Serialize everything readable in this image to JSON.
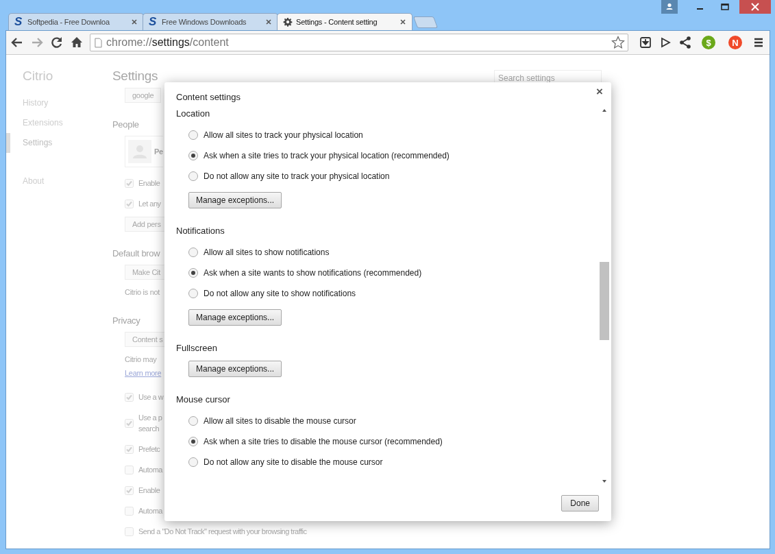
{
  "tabs": [
    {
      "label": "Softpedia - Free Downloa",
      "kind": "logo",
      "logo": "S",
      "selected": false
    },
    {
      "label": "Free Windows Downloads",
      "kind": "logo",
      "logo": "S",
      "selected": false
    },
    {
      "label": "Settings - Content setting",
      "kind": "gear",
      "selected": true
    }
  ],
  "address_bar": {
    "scheme": "chrome://",
    "host": "settings",
    "path": "/content"
  },
  "extensions": [
    {
      "label": "$",
      "color": "#6aa81a"
    },
    {
      "label": "N",
      "color": "#f04a2a"
    }
  ],
  "sidebar": {
    "title": "Citrio",
    "items": [
      {
        "label": "History",
        "selected": false
      },
      {
        "label": "Extensions",
        "selected": false
      },
      {
        "label": "Settings",
        "selected": true
      },
      {
        "label": "About",
        "selected": false
      }
    ]
  },
  "settings_page": {
    "title": "Settings",
    "search": {
      "placeholder": "Search settings"
    },
    "items": [
      {
        "kind": "button",
        "label": "google"
      },
      {
        "kind": "heading",
        "label": "People"
      },
      {
        "kind": "profile",
        "label": "Pe"
      },
      {
        "kind": "checkbox",
        "label": "Enable",
        "checked": true
      },
      {
        "kind": "checkbox",
        "label": "Let any",
        "checked": true
      },
      {
        "kind": "button",
        "label": "Add pers"
      },
      {
        "kind": "heading",
        "label": "Default brow"
      },
      {
        "kind": "button",
        "label": "Make Cit"
      },
      {
        "kind": "text",
        "label": "Citrio is not"
      },
      {
        "kind": "heading",
        "label": "Privacy"
      },
      {
        "kind": "button",
        "label": "Content s"
      },
      {
        "kind": "text",
        "label": "Citrio may"
      },
      {
        "kind": "link",
        "label": "Learn more"
      },
      {
        "kind": "checkbox",
        "label": "Use a w",
        "checked": true
      },
      {
        "kind": "checkbox",
        "label": "Use a p",
        "label_line_2": "search",
        "checked": true
      },
      {
        "kind": "checkbox",
        "label": "Prefetc",
        "checked": true
      },
      {
        "kind": "checkbox",
        "label": "Automa",
        "checked": false
      },
      {
        "kind": "checkbox",
        "label": "Enable",
        "checked": true
      },
      {
        "kind": "checkbox",
        "label": "Automa",
        "checked": false
      },
      {
        "kind": "checkbox",
        "label": "Send a \"Do Not Track\" request with your browsing traffic",
        "checked": false
      }
    ]
  },
  "dialog": {
    "title": "Content settings",
    "close": "×",
    "sections": [
      {
        "title": "Location",
        "options": [
          {
            "label": "Allow all sites to track your physical location",
            "selected": false
          },
          {
            "label": "Ask when a site tries to track your physical location (recommended)",
            "selected": true
          },
          {
            "label": "Do not allow any site to track your physical location",
            "selected": false
          }
        ],
        "button": "Manage exceptions..."
      },
      {
        "title": "Notifications",
        "options": [
          {
            "label": "Allow all sites to show notifications",
            "selected": false
          },
          {
            "label": "Ask when a site wants to show notifications (recommended)",
            "selected": true
          },
          {
            "label": "Do not allow any site to show notifications",
            "selected": false
          }
        ],
        "button": "Manage exceptions..."
      },
      {
        "title": "Fullscreen",
        "button": "Manage exceptions..."
      },
      {
        "title": "Mouse cursor",
        "options": [
          {
            "label": "Allow all sites to disable the mouse cursor",
            "selected": false
          },
          {
            "label": "Ask when a site tries to disable the mouse cursor (recommended)",
            "selected": true
          },
          {
            "label": "Do not allow any site to disable the mouse cursor",
            "selected": false
          }
        ]
      }
    ],
    "done": "Done"
  }
}
